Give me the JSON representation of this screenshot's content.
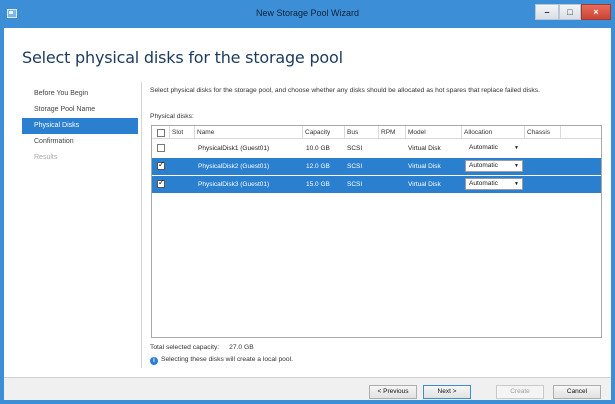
{
  "window": {
    "title": "New Storage Pool Wizard"
  },
  "page_title": "Select physical disks for the storage pool",
  "nav": {
    "items": [
      {
        "label": "Before You Begin",
        "state": "normal"
      },
      {
        "label": "Storage Pool Name",
        "state": "normal"
      },
      {
        "label": "Physical Disks",
        "state": "selected"
      },
      {
        "label": "Confirmation",
        "state": "normal"
      },
      {
        "label": "Results",
        "state": "disabled"
      }
    ]
  },
  "intro_text": "Select physical disks for the storage pool, and choose whether any disks should be allocated as hot spares that replace failed disks.",
  "physical_disks_label": "Physical disks:",
  "table": {
    "columns": [
      "Slot",
      "Name",
      "Capacity",
      "Bus",
      "RPM",
      "Model",
      "Allocation",
      "Chassis"
    ],
    "rows": [
      {
        "checked": false,
        "selected": false,
        "slot": "",
        "name": "PhysicalDisk1 (Guest01)",
        "capacity": "10.0 GB",
        "bus": "SCSI",
        "rpm": "",
        "model": "Virtual Disk",
        "allocation": "Automatic",
        "chassis": ""
      },
      {
        "checked": true,
        "selected": true,
        "slot": "",
        "name": "PhysicalDisk2 (Guest01)",
        "capacity": "12.0 GB",
        "bus": "SCSI",
        "rpm": "",
        "model": "Virtual Disk",
        "allocation": "Automatic",
        "chassis": ""
      },
      {
        "checked": true,
        "selected": true,
        "slot": "",
        "name": "PhysicalDisk3 (Guest01)",
        "capacity": "15.0 GB",
        "bus": "SCSI",
        "rpm": "",
        "model": "Virtual Disk",
        "allocation": "Automatic",
        "chassis": ""
      }
    ]
  },
  "total_label": "Total selected capacity:",
  "total_value": "27.0 GB",
  "info_text": "Selecting these disks will create a local pool.",
  "buttons": {
    "previous": "< Previous",
    "next": "Next >",
    "create": "Create",
    "cancel": "Cancel"
  },
  "colors": {
    "accent": "#2a7fcf",
    "titlebar": "#3c8fd6",
    "close": "#c84535"
  },
  "icons": {
    "app": "storage-wizard-icon",
    "info": "info-icon",
    "minimize": "minimize-icon",
    "maximize": "maximize-icon",
    "close": "close-icon"
  }
}
